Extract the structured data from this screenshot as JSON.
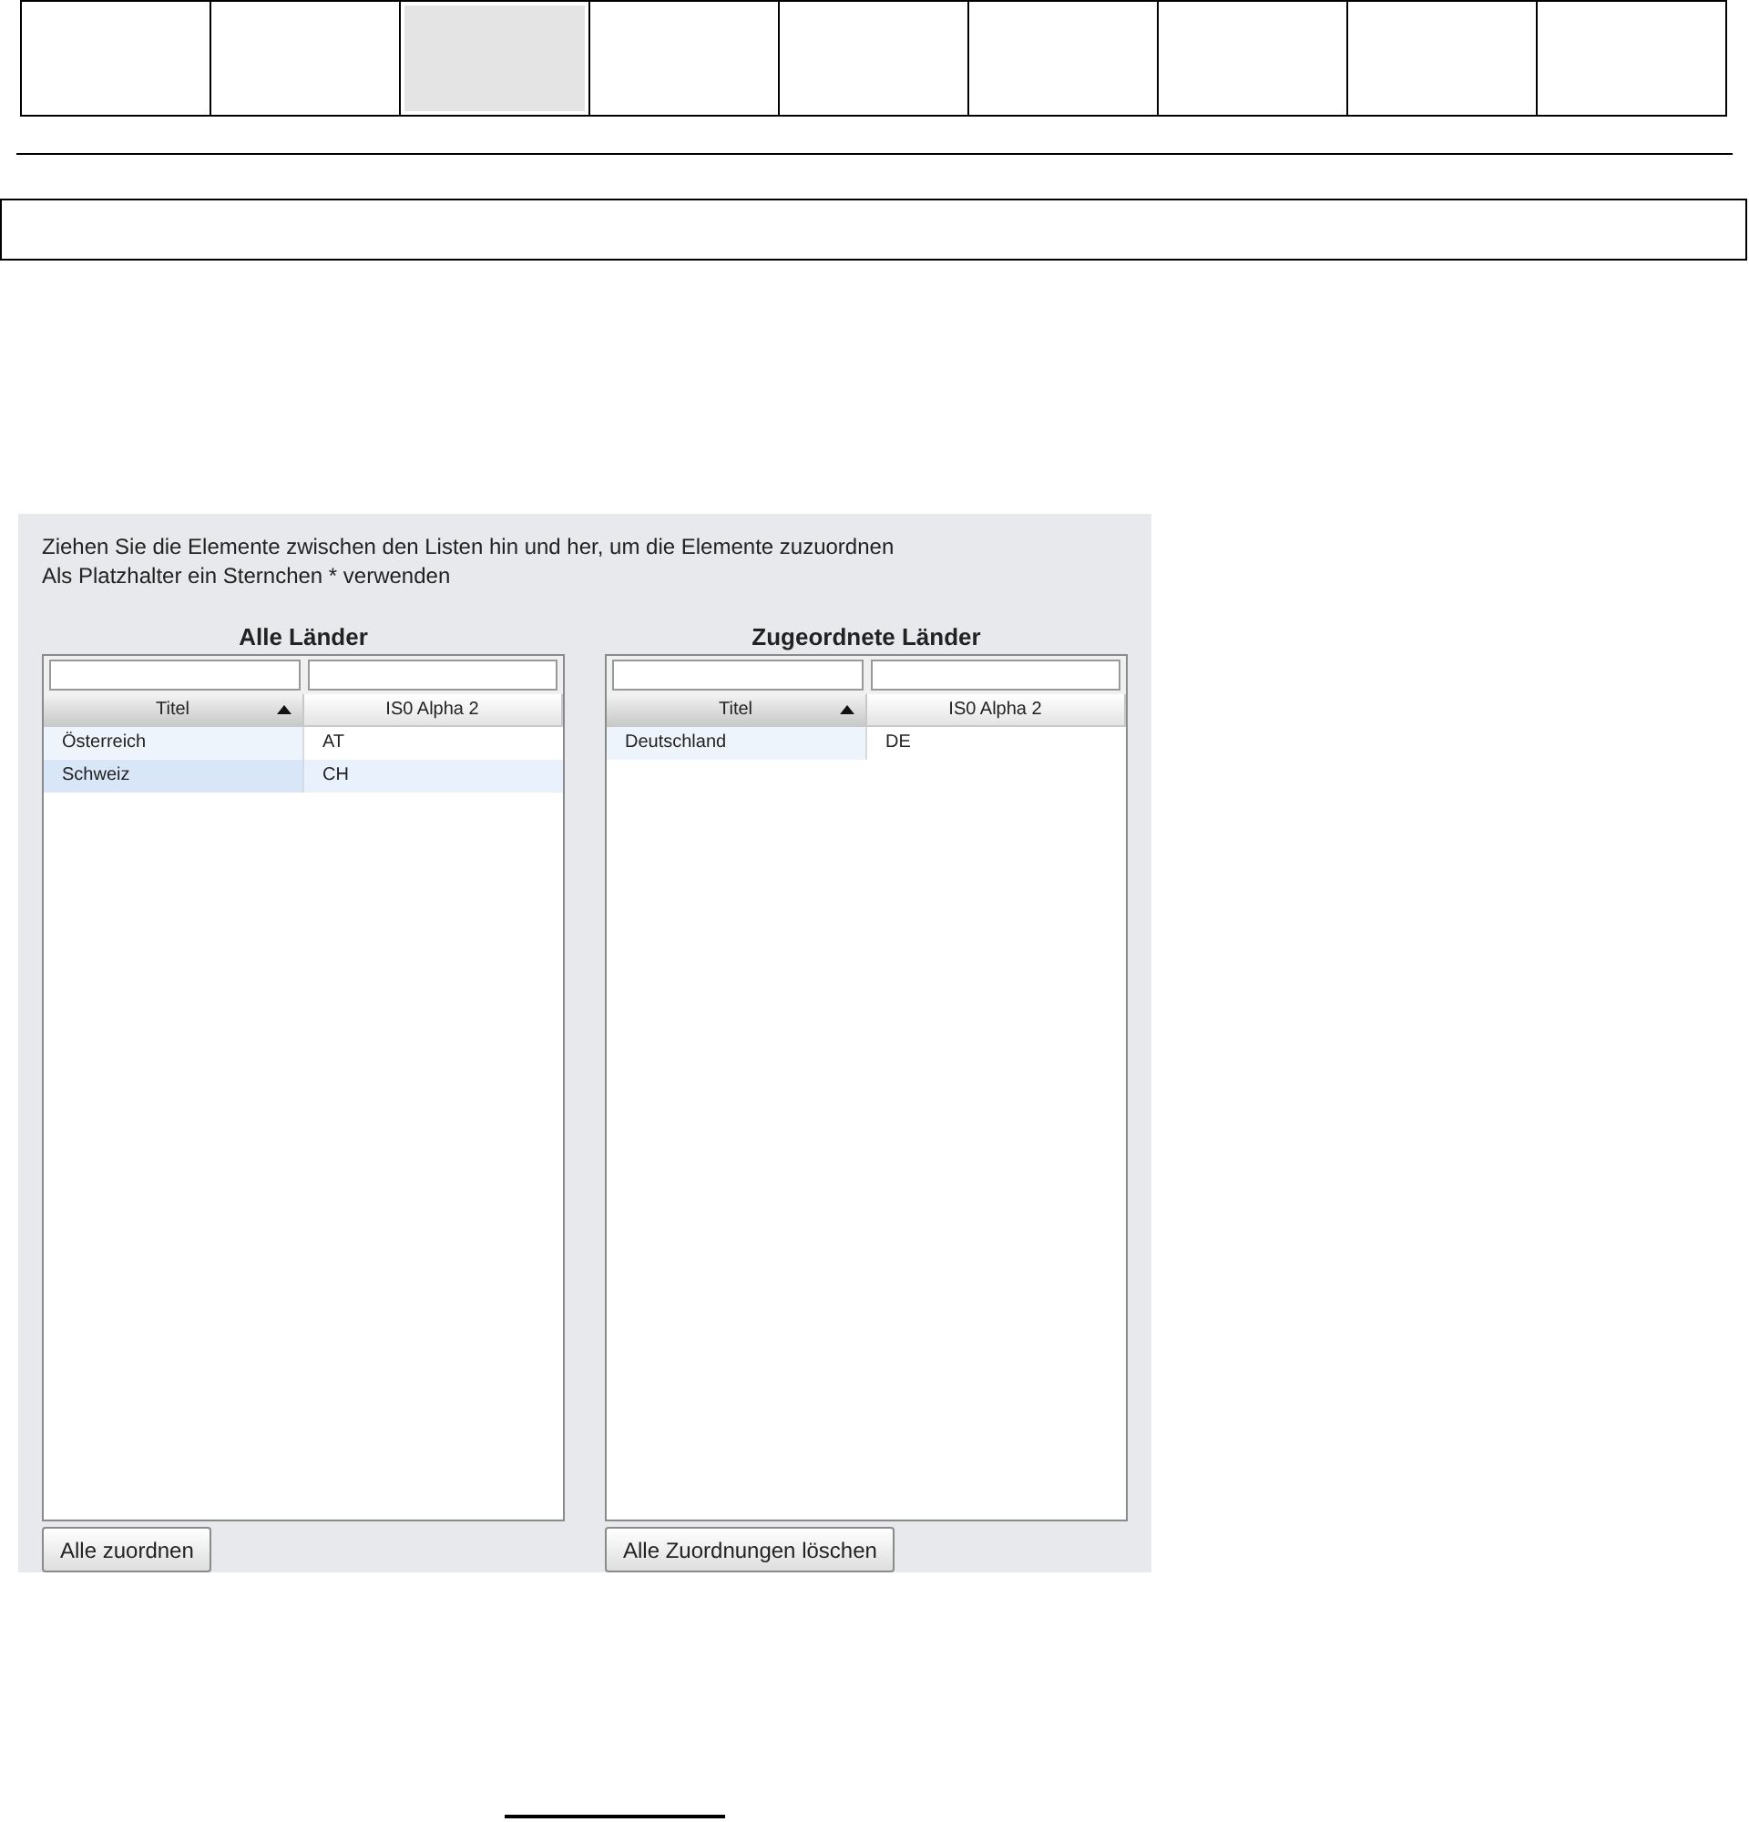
{
  "top_cells": [
    {
      "selected": false
    },
    {
      "selected": false
    },
    {
      "selected": true
    },
    {
      "selected": false
    },
    {
      "selected": false
    },
    {
      "selected": false
    },
    {
      "selected": false
    },
    {
      "selected": false
    },
    {
      "selected": false
    }
  ],
  "instructions": [
    "Ziehen Sie die Elemente zwischen den Listen hin und her, um die Elemente zuzuordnen",
    "Als Platzhalter ein Sternchen * verwenden"
  ],
  "lists": [
    {
      "title": "Alle Länder",
      "columns": [
        {
          "label": "Titel",
          "sorted": true
        },
        {
          "label": "IS0 Alpha 2",
          "sorted": false
        }
      ],
      "rows": [
        {
          "cells": [
            "Österreich",
            "AT"
          ],
          "selected": false
        },
        {
          "cells": [
            "Schweiz",
            "CH"
          ],
          "selected": true
        }
      ],
      "button": "Alle zuordnen"
    },
    {
      "title": "Zugeordnete Länder",
      "columns": [
        {
          "label": "Titel",
          "sorted": true
        },
        {
          "label": "IS0 Alpha 2",
          "sorted": false
        }
      ],
      "rows": [
        {
          "cells": [
            "Deutschland",
            "DE"
          ],
          "selected": false
        }
      ],
      "button": "Alle Zuordnungen löschen"
    }
  ]
}
